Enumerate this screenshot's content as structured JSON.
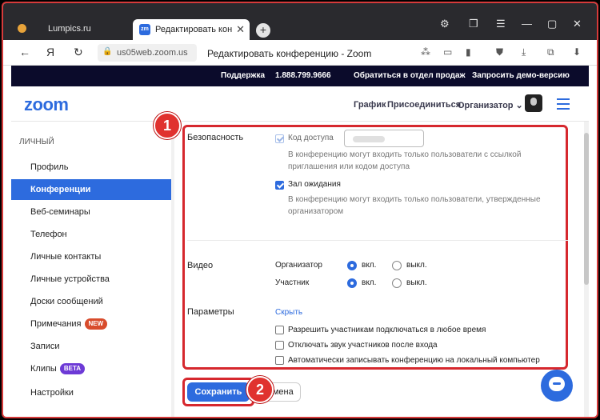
{
  "browser": {
    "tabs": [
      {
        "label": "Lumpics.ru"
      },
      {
        "label": "Редактировать конфе"
      }
    ],
    "url": "us05web.zoom.us",
    "page_title": "Редактировать конференцию - Zoom",
    "favicon_text": "zm"
  },
  "zoom_strip": {
    "support": "Поддержка",
    "phone": "1.888.799.9666",
    "sales": "Обратиться в отдел продаж",
    "demo": "Запросить демо-версию"
  },
  "header": {
    "logo": "zoom",
    "links": [
      "График",
      "Присоединиться",
      "Организатор ⌄"
    ]
  },
  "sidebar": {
    "heading": "личный",
    "items": [
      {
        "label": "Профиль"
      },
      {
        "label": "Конференции",
        "active": true
      },
      {
        "label": "Веб-семинары"
      },
      {
        "label": "Телефон"
      },
      {
        "label": "Личные контакты"
      },
      {
        "label": "Личные устройства"
      },
      {
        "label": "Доски сообщений"
      },
      {
        "label": "Примечания",
        "badge": "NEW"
      },
      {
        "label": "Записи"
      },
      {
        "label": "Клипы",
        "badge": "BETA"
      },
      {
        "label": "Настройки"
      }
    ]
  },
  "security": {
    "label": "Безопасность",
    "passcode_label": "Код доступа",
    "passcode_help": "В конференцию могут входить только пользователи с ссылкой приглашения или кодом доступа",
    "waiting_label": "Зал ожидания",
    "waiting_help": "В конференцию могут входить только пользователи, утвержденные организатором"
  },
  "video": {
    "label": "Видео",
    "host_label": "Организатор",
    "participant_label": "Участник",
    "on": "вкл.",
    "off": "выкл."
  },
  "options": {
    "label": "Параметры",
    "hide_link": "Скрыть",
    "items": [
      "Разрешить участникам подключаться в любое время",
      "Отключать звук участников после входа",
      "Автоматически записывать конференцию на локальный компьютер"
    ]
  },
  "actions": {
    "save": "Сохранить",
    "cancel": "Отмена"
  },
  "steps": [
    "1",
    "2"
  ]
}
